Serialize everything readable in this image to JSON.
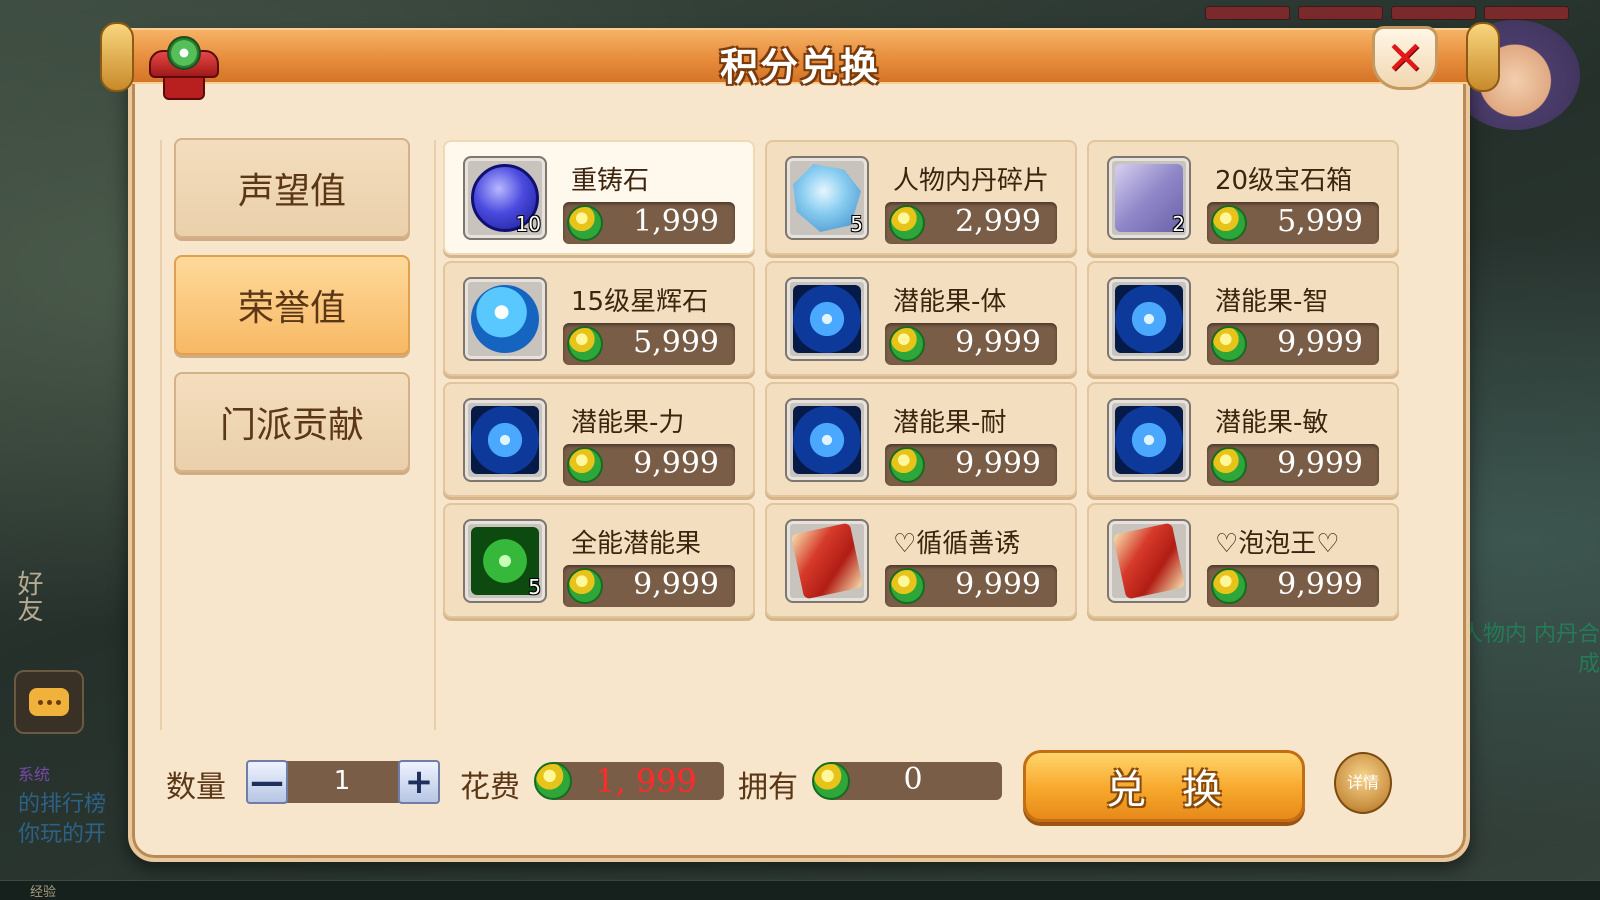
{
  "dialog": {
    "title": "积分兑换",
    "close_glyph": "✕"
  },
  "tabs": [
    {
      "label": "声望值",
      "active": false
    },
    {
      "label": "荣誉值",
      "active": true
    },
    {
      "label": "门派贡献",
      "active": false
    }
  ],
  "items": [
    {
      "name": "重铸石",
      "price": "1,999",
      "count": "10",
      "icon": "reforge-stone-icon",
      "selected": true
    },
    {
      "name": "人物内丹碎片",
      "price": "2,999",
      "count": "5",
      "icon": "neidan-fragment-icon",
      "selected": false
    },
    {
      "name": "20级宝石箱",
      "price": "5,999",
      "count": "2",
      "icon": "gem-box-icon",
      "selected": false
    },
    {
      "name": "15级星辉石",
      "price": "5,999",
      "count": "",
      "icon": "starlight-stone-icon",
      "selected": false
    },
    {
      "name": "潜能果-体",
      "price": "9,999",
      "count": "",
      "icon": "potential-fruit-icon",
      "selected": false
    },
    {
      "name": "潜能果-智",
      "price": "9,999",
      "count": "",
      "icon": "potential-fruit-icon",
      "selected": false
    },
    {
      "name": "潜能果-力",
      "price": "9,999",
      "count": "",
      "icon": "potential-fruit-icon",
      "selected": false
    },
    {
      "name": "潜能果-耐",
      "price": "9,999",
      "count": "",
      "icon": "potential-fruit-icon",
      "selected": false
    },
    {
      "name": "潜能果-敏",
      "price": "9,999",
      "count": "",
      "icon": "potential-fruit-icon",
      "selected": false
    },
    {
      "name": "全能潜能果",
      "price": "9,999",
      "count": "5",
      "icon": "omni-potential-fruit-icon",
      "selected": false
    },
    {
      "name": "♡循循善诱",
      "price": "9,999",
      "count": "",
      "icon": "title-card-icon",
      "selected": false
    },
    {
      "name": "♡泡泡王♡",
      "price": "9,999",
      "count": "",
      "icon": "title-card-icon",
      "selected": false
    }
  ],
  "bottom": {
    "quantity_label": "数量",
    "quantity_value": "1",
    "minus_glyph": "—",
    "plus_glyph": "+",
    "cost_label": "花费",
    "cost_value": "1, 999",
    "own_label": "拥有",
    "own_value": "0",
    "exchange_label": "兑换",
    "detail_label": "详情"
  },
  "background": {
    "left_side_text": "好友",
    "chat_tag": "系统",
    "chat_text": "的排行榜 你玩的开",
    "right_hint": "人物内 内丹合成",
    "exp_label": "经验"
  }
}
